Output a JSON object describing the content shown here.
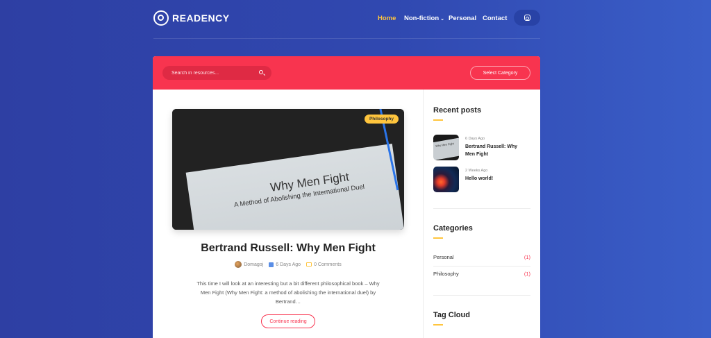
{
  "brand": {
    "name": "READENCY"
  },
  "nav": {
    "items": [
      {
        "label": "Home"
      },
      {
        "label": "Non-fiction"
      },
      {
        "label": "Personal"
      },
      {
        "label": "Contact"
      }
    ],
    "dropdown_glyph": "⌄"
  },
  "search": {
    "placeholder": "Search in resources..."
  },
  "category_select": {
    "label": "Select Category"
  },
  "post": {
    "badge": "Philosophy",
    "image_text": {
      "title": "Why Men Fight",
      "subtitle": "A Method of Abolishing the International Duel"
    },
    "title": "Bertrand Russell: Why Men Fight",
    "author": "Domagoj",
    "date": "6 Days Ago",
    "comments": "0 Comments",
    "excerpt": "This time I will look at an interesting but a bit different philosophical book – Why Men Fight (Why Men Fight: a method of abolishing the international duel) by Bertrand…",
    "cta": "Continue reading"
  },
  "sidebar": {
    "recent": {
      "title": "Recent posts",
      "items": [
        {
          "date": "6 Days Ago",
          "title": "Bertrand Russell: Why Men Fight",
          "thumb_text": "Why Men Fight"
        },
        {
          "date": "2 Weeks Ago",
          "title": "Hello world!"
        }
      ]
    },
    "categories": {
      "title": "Categories",
      "items": [
        {
          "name": "Personal",
          "count": "(1)"
        },
        {
          "name": "Philosophy",
          "count": "(1)"
        }
      ]
    },
    "tag_cloud": {
      "title": "Tag Cloud"
    }
  },
  "colors": {
    "accent": "#f8344f",
    "highlight": "#ffc53d",
    "background": "#3048b0"
  }
}
